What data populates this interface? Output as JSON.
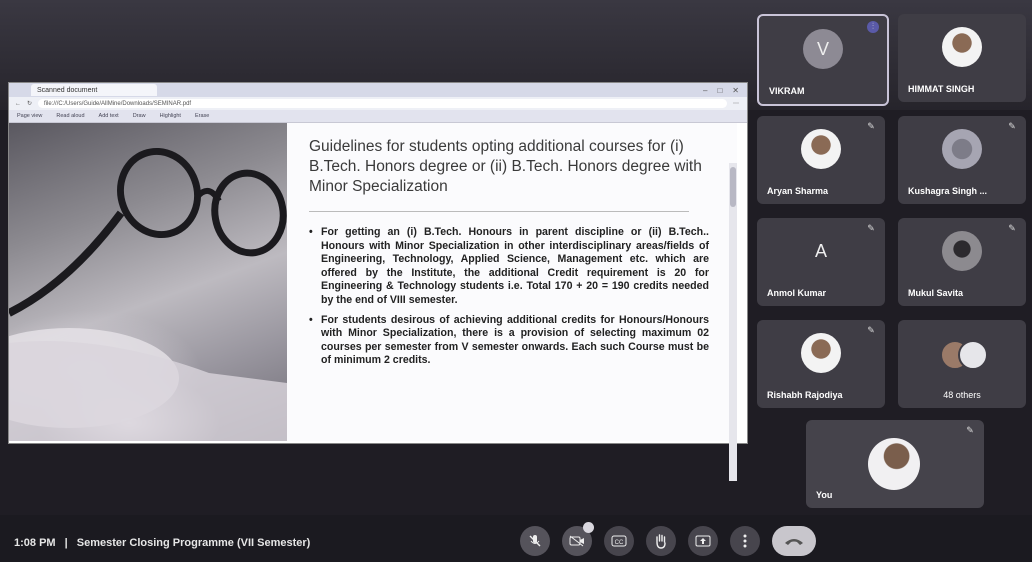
{
  "browser": {
    "tab_title": "Scanned document",
    "url": "file:///C:/Users/Guide/AllMine/Downloads/SEMINAR.pdf",
    "toolbar_items": [
      "Page view",
      "Read aloud",
      "Add text",
      "Draw",
      "Highlight",
      "Erase"
    ]
  },
  "slide": {
    "title": "Guidelines for students opting additional courses for (i) B.Tech. Honors degree or (ii) B.Tech. Honors degree with Minor Specialization",
    "bullets": [
      "For getting an (i) B.Tech. Honours in parent discipline or (ii) B.Tech.. Honours with Minor Specialization in other interdisciplinary areas/fields of Engineering, Technology, Applied Science, Management etc. which are offered by the Institute, the additional Credit requirement is 20 for Engineering & Technology students i.e. Total 170 + 20 = 190 credits needed by the end of VIII semester.",
      "For students desirous of achieving additional credits for Honours/Honours with Minor Specialization, there is a provision of selecting maximum 02 courses per semester from V semester onwards. Each such Course must be of minimum 2 credits."
    ]
  },
  "participants": [
    {
      "name": "VIKRAM",
      "avatar": "V"
    },
    {
      "name": "HIMMAT SINGH",
      "avatar": "photo"
    },
    {
      "name": "Aryan Sharma",
      "avatar": "photo"
    },
    {
      "name": "Kushagra Singh ...",
      "avatar": "photo"
    },
    {
      "name": "Anmol Kumar",
      "avatar": "A"
    },
    {
      "name": "Mukul Savita",
      "avatar": "photo"
    },
    {
      "name": "Rishabh Rajodiya",
      "avatar": "photo"
    },
    {
      "name": "48 others",
      "avatar": "group"
    }
  ],
  "self_tile": {
    "name": "You"
  },
  "meeting": {
    "time": "1:08 PM",
    "separator": "|",
    "title": "Semester Closing Programme (VII Semester)"
  },
  "icons": {
    "mic": "mic-off-icon",
    "camera": "camera-off-icon",
    "captions": "captions-icon",
    "raise_hand": "raise-hand-icon",
    "present": "present-icon",
    "more": "more-options-icon",
    "end_call": "end-call-icon"
  },
  "colors": {
    "background": "#1f1d24",
    "tile": "#3f3d45",
    "active_speaker_border": "#c9c4d8",
    "end_call": "#c8c6cc"
  }
}
